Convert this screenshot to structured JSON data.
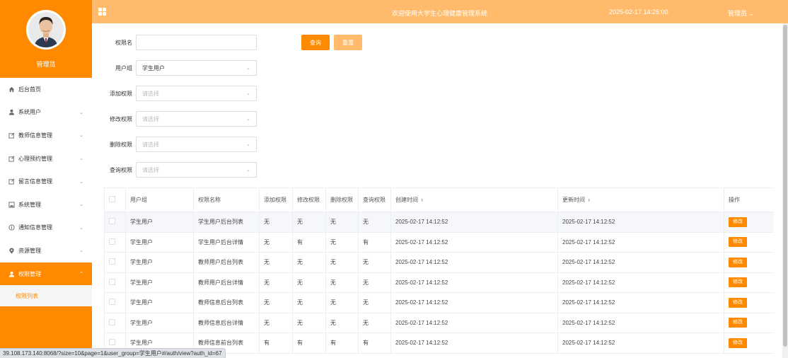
{
  "header": {
    "title": "欢迎使用大学生心理健康管理系统",
    "time": "2025-02-17 14:25:00",
    "user": "管理员",
    "user_caret": "⌄",
    "bg_color": "#ffbb6b"
  },
  "sidebar": {
    "profile_name": "管理员",
    "accent_color": "#ff8a00",
    "items": [
      {
        "label": "后台首页",
        "icon": "home-icon"
      },
      {
        "label": "系统用户",
        "icon": "user-icon"
      },
      {
        "label": "教师信息管理",
        "icon": "edit-icon"
      },
      {
        "label": "心理预约管理",
        "icon": "edit-icon"
      },
      {
        "label": "留言信息管理",
        "icon": "edit-icon"
      },
      {
        "label": "系统管理",
        "icon": "picture-icon"
      },
      {
        "label": "通知信息管理",
        "icon": "info-icon"
      },
      {
        "label": "资源管理",
        "icon": "location-icon"
      },
      {
        "label": "权限管理",
        "icon": "user-icon"
      }
    ],
    "subitem": "权限列表"
  },
  "form": {
    "name_label": "权限名",
    "name_value": "",
    "group_label": "用户组",
    "group_value": "学生用户",
    "add_label": "添加权限",
    "edit_label": "修改权限",
    "delete_label": "删除权限",
    "view_label": "查询权限",
    "placeholder": "请选择",
    "query_button": "查询",
    "reset_button": "重置"
  },
  "table": {
    "headers": {
      "group": "用户组",
      "name": "权限名称",
      "add": "添加权限",
      "edit": "修改权限",
      "delete": "删除权限",
      "view": "查询权限",
      "created": "创建时间",
      "updated": "更新时间",
      "action": "操作"
    },
    "sort_icon": "⬍",
    "edit_button": "修改",
    "rows": [
      {
        "group": "学生用户",
        "name": "学生用户后台列表",
        "add": "无",
        "edit": "无",
        "delete": "无",
        "view": "无",
        "created": "2025-02-17 14:12:52",
        "updated": "2025-02-17 14:12:52"
      },
      {
        "group": "学生用户",
        "name": "学生用户后台详情",
        "add": "无",
        "edit": "有",
        "delete": "无",
        "view": "有",
        "created": "2025-02-17 14:12:52",
        "updated": "2025-02-17 14:12:52"
      },
      {
        "group": "学生用户",
        "name": "教师用户后台列表",
        "add": "无",
        "edit": "无",
        "delete": "无",
        "view": "无",
        "created": "2025-02-17 14:12:52",
        "updated": "2025-02-17 14:12:52"
      },
      {
        "group": "学生用户",
        "name": "教师用户后台详情",
        "add": "无",
        "edit": "无",
        "delete": "无",
        "view": "无",
        "created": "2025-02-17 14:12:52",
        "updated": "2025-02-17 14:12:52"
      },
      {
        "group": "学生用户",
        "name": "教师信息后台列表",
        "add": "无",
        "edit": "无",
        "delete": "无",
        "view": "无",
        "created": "2025-02-17 14:12:52",
        "updated": "2025-02-17 14:12:52"
      },
      {
        "group": "学生用户",
        "name": "教师信息后台详情",
        "add": "无",
        "edit": "无",
        "delete": "无",
        "view": "无",
        "created": "2025-02-17 14:12:52",
        "updated": "2025-02-17 14:12:52"
      },
      {
        "group": "学生用户",
        "name": "教师信息前台列表",
        "add": "有",
        "edit": "有",
        "delete": "有",
        "view": "有",
        "created": "2025-02-17 14:12:52",
        "updated": "2025-02-17 14:12:52"
      }
    ]
  },
  "statusbar": {
    "url": "39.108.173.140:8068/?size=10&page=1&user_group=学生用户#/auth/view?auth_id=67"
  }
}
